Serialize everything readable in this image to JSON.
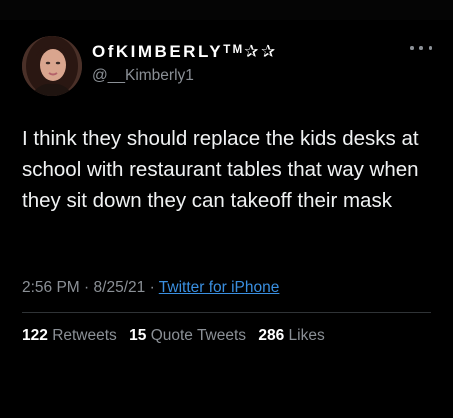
{
  "tweet": {
    "display_name": "OfKIMBERLYᵀᴹ✰✰",
    "username": "@__Kimberly1",
    "text": "I think they should replace the kids desks at school with restaurant tables that way when they sit down they can takeoff their mask",
    "time": "2:56 PM",
    "date": "8/25/21",
    "separator": "·",
    "source": "Twitter for iPhone",
    "avatar_icon": "profile-photo",
    "more_icon": "more-options-icon"
  },
  "stats": {
    "retweets_count": "122",
    "retweets_label": "Retweets",
    "quote_tweets_count": "15",
    "quote_tweets_label": "Quote Tweets",
    "likes_count": "286",
    "likes_label": "Likes"
  },
  "colors": {
    "background": "#000000",
    "text": "#e7e9ea",
    "muted": "#8b9096",
    "link": "#3a8fe0",
    "divider": "#2f3336"
  }
}
